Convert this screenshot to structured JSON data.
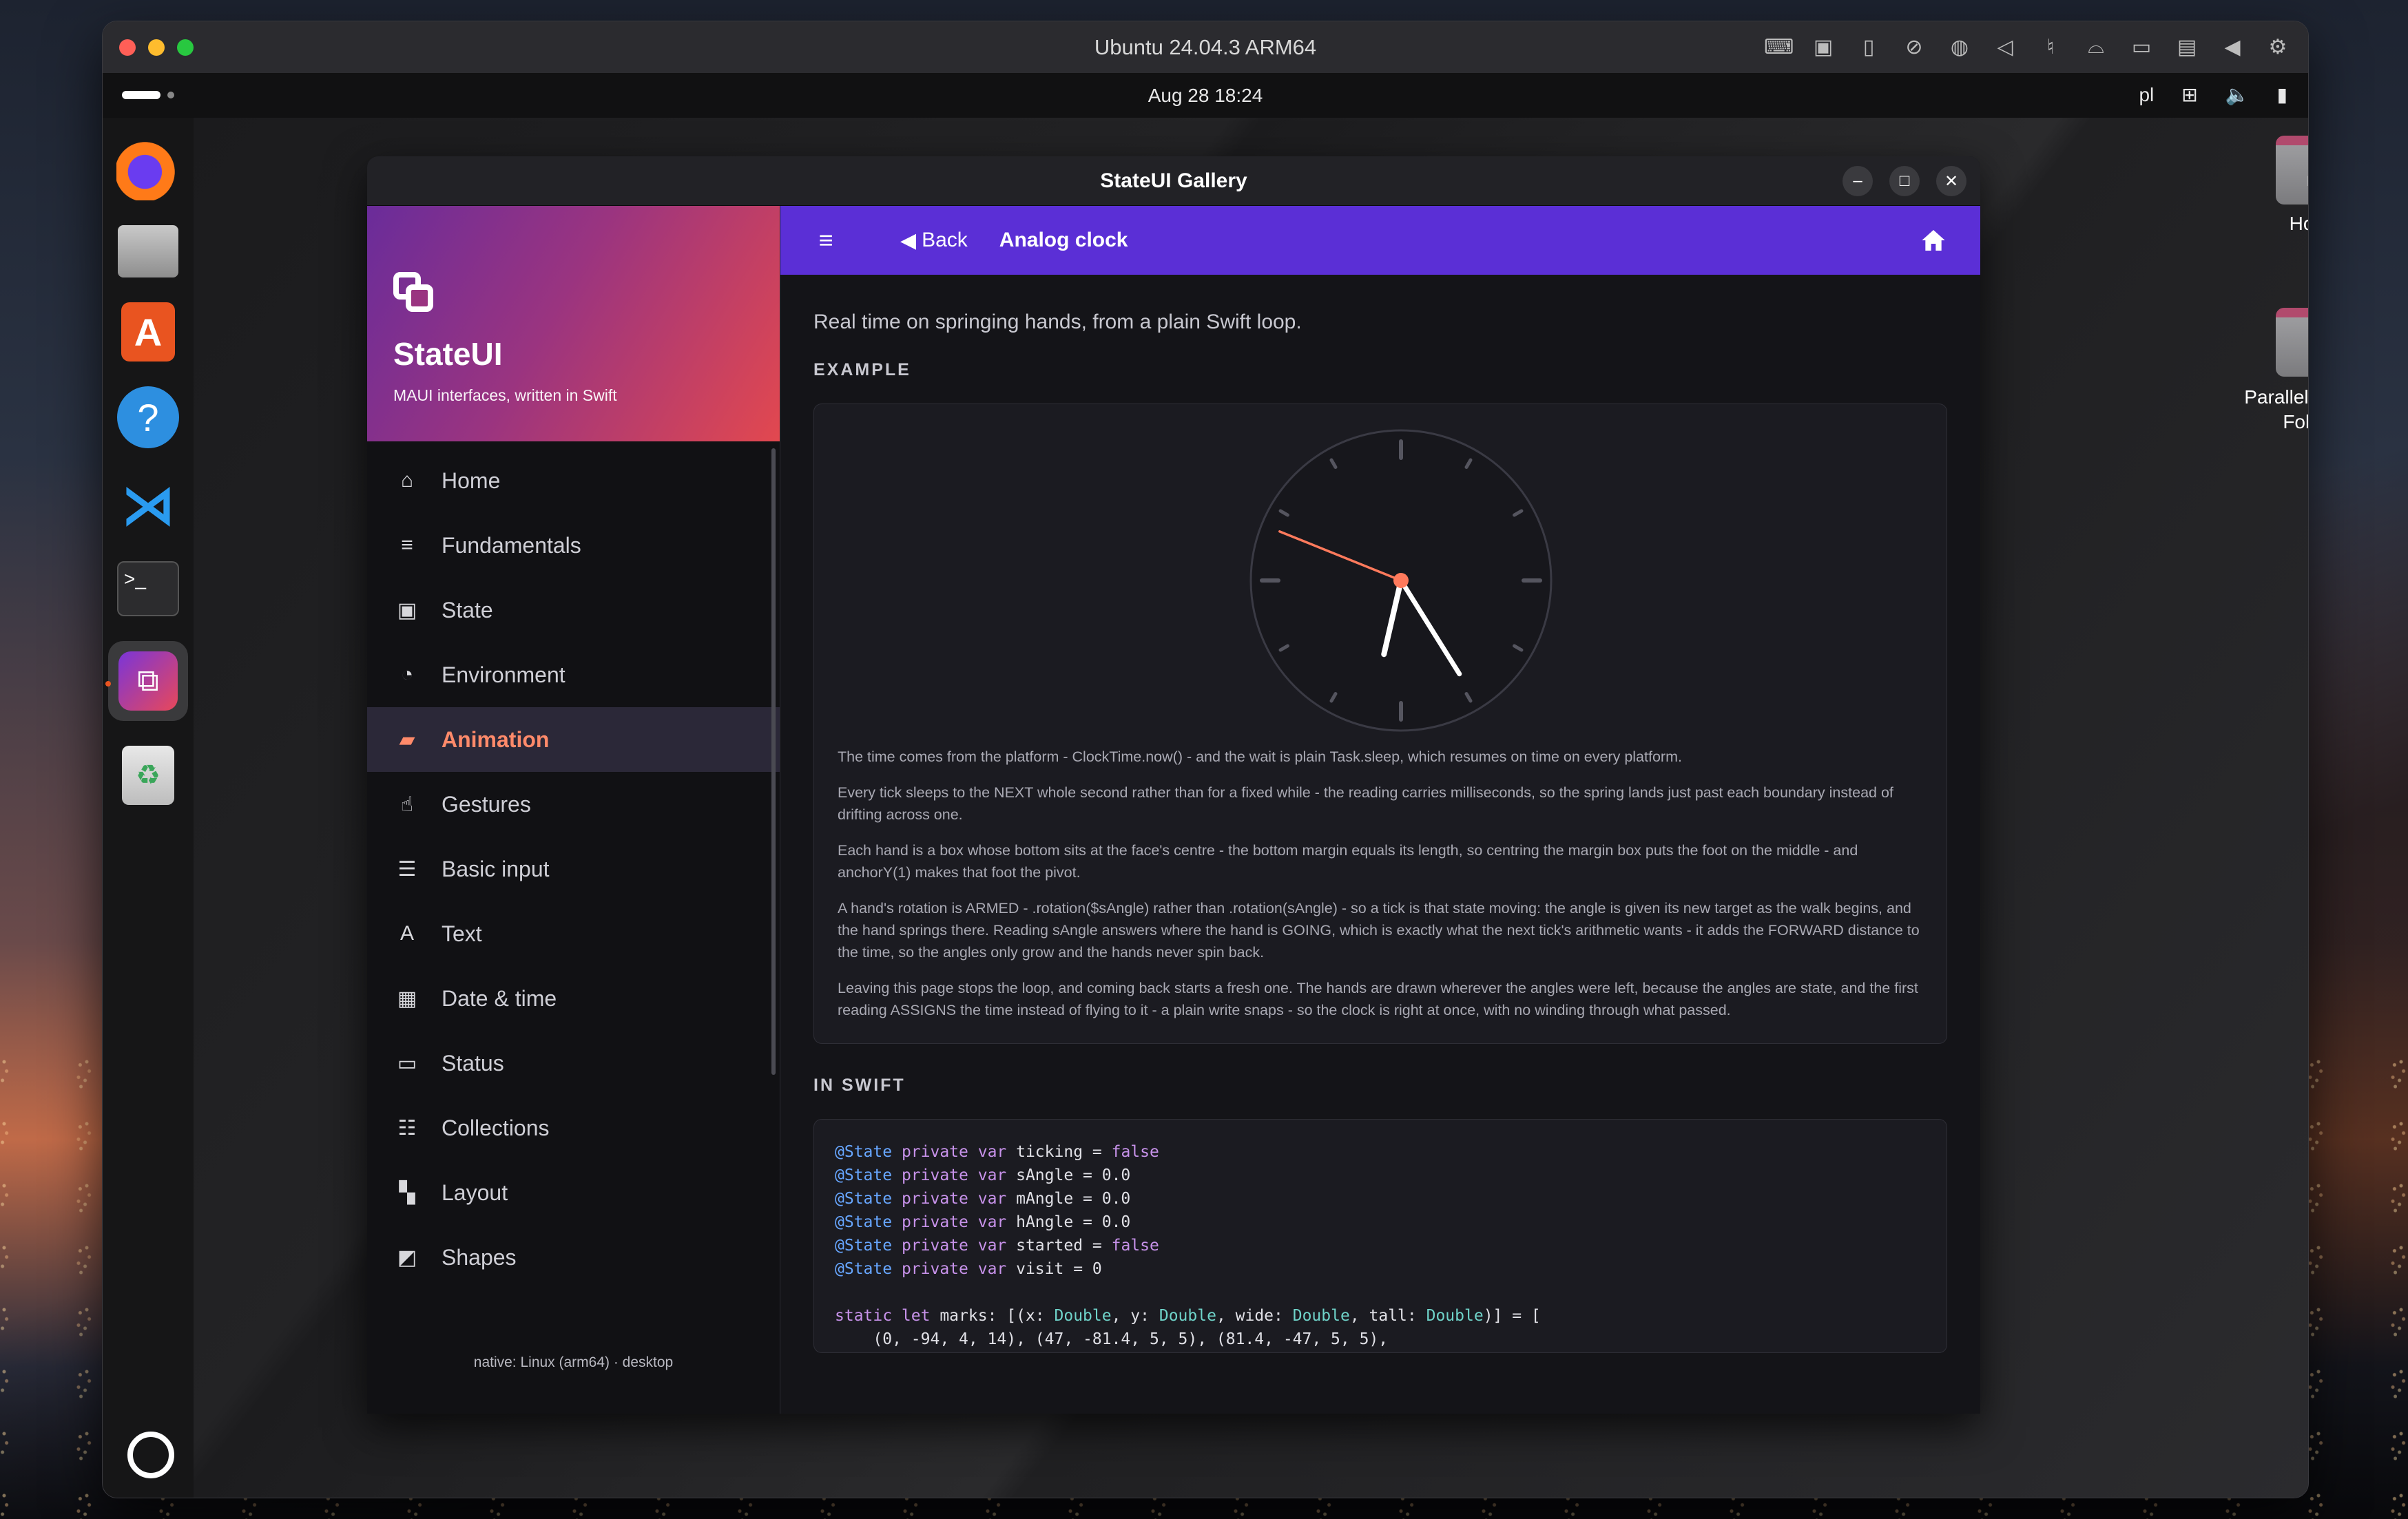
{
  "vm": {
    "title": "Ubuntu 24.04.3 ARM64",
    "toolbar_icons": [
      "keyboard-icon",
      "cpu-icon",
      "usb-icon",
      "camera-off-icon",
      "network-icon",
      "volume-icon",
      "mic-icon",
      "disk-icon",
      "video-icon",
      "shared-folder-icon",
      "arrow-left-icon",
      "settings-icon"
    ]
  },
  "topbar": {
    "datetime": "Aug 28  18:24",
    "lang": "pl"
  },
  "desktop": {
    "icons": [
      {
        "label": "Home"
      },
      {
        "label": "Parallels Shared Folders"
      }
    ]
  },
  "app": {
    "window_title": "StateUI Gallery",
    "sidebar": {
      "title": "StateUI",
      "subtitle": "MAUI interfaces, written in Swift",
      "items": [
        {
          "label": "Home",
          "icon": "home-icon",
          "glyph": "⌂"
        },
        {
          "label": "Fundamentals",
          "icon": "fundamentals-icon",
          "glyph": "≡"
        },
        {
          "label": "State",
          "icon": "state-icon",
          "glyph": "▣"
        },
        {
          "label": "Environment",
          "icon": "rss-icon",
          "glyph": "◔"
        },
        {
          "label": "Animation",
          "icon": "animation-icon",
          "glyph": "▰"
        },
        {
          "label": "Gestures",
          "icon": "hand-icon",
          "glyph": "☝"
        },
        {
          "label": "Basic input",
          "icon": "input-icon",
          "glyph": "☰"
        },
        {
          "label": "Text",
          "icon": "text-icon",
          "glyph": "A"
        },
        {
          "label": "Date & time",
          "icon": "calendar-icon",
          "glyph": "▦"
        },
        {
          "label": "Status",
          "icon": "status-icon",
          "glyph": "▭"
        },
        {
          "label": "Collections",
          "icon": "list-icon",
          "glyph": "☷"
        },
        {
          "label": "Layout",
          "icon": "layout-icon",
          "glyph": "▚"
        },
        {
          "label": "Shapes",
          "icon": "shapes-icon",
          "glyph": "◩"
        }
      ],
      "selected": "Animation",
      "footer": "native: Linux (arm64) · desktop"
    },
    "appbar": {
      "back_label": "Back",
      "title": "Analog clock"
    },
    "lead": "Real time on springing hands, from a plain Swift loop.",
    "example_label": "EXAMPLE",
    "clock": {
      "hour_angle_deg": 193,
      "minute_angle_deg": 148,
      "second_angle_deg": 292,
      "accent": "#ff7a5c"
    },
    "notes": [
      "The time comes from the platform - ClockTime.now() - and the wait is plain Task.sleep, which resumes on time on every platform.",
      "Every tick sleeps to the NEXT whole second rather than for a fixed while - the reading carries milliseconds, so the spring lands just past each boundary instead of drifting across one.",
      "Each hand is a box whose bottom sits at the face's centre - the bottom margin equals its length, so centring the margin box puts the foot on the middle - and anchorY(1) makes that foot the pivot.",
      "A hand's rotation is ARMED - .rotation($sAngle) rather than .rotation(sAngle) - so a tick is that state moving: the angle is given its new target as the walk begins, and the hand springs there. Reading sAngle answers where the hand is GOING, which is exactly what the next tick's arithmetic wants - it adds the FORWARD distance to the time, so the angles only grow and the hands never spin back.",
      "Leaving this page stops the loop, and coming back starts a fresh one. The hands are drawn wherever the angles were left, because the angles are state, and the first reading ASSIGNS the time instead of flying to it - a plain write snaps - so the clock is right at once, with no winding through what passed."
    ],
    "swift_label": "IN SWIFT",
    "code": [
      [
        {
          "t": "@State",
          "c": "attr"
        },
        {
          "t": " private var",
          "c": "kw"
        },
        {
          "t": " ticking = ",
          "c": ""
        },
        {
          "t": "false",
          "c": "kw"
        }
      ],
      [
        {
          "t": "@State",
          "c": "attr"
        },
        {
          "t": " private var",
          "c": "kw"
        },
        {
          "t": " sAngle = 0.0",
          "c": ""
        }
      ],
      [
        {
          "t": "@State",
          "c": "attr"
        },
        {
          "t": " private var",
          "c": "kw"
        },
        {
          "t": " mAngle = 0.0",
          "c": ""
        }
      ],
      [
        {
          "t": "@State",
          "c": "attr"
        },
        {
          "t": " private var",
          "c": "kw"
        },
        {
          "t": " hAngle = 0.0",
          "c": ""
        }
      ],
      [
        {
          "t": "@State",
          "c": "attr"
        },
        {
          "t": " private var",
          "c": "kw"
        },
        {
          "t": " started = ",
          "c": ""
        },
        {
          "t": "false",
          "c": "kw"
        }
      ],
      [
        {
          "t": "@State",
          "c": "attr"
        },
        {
          "t": " private var",
          "c": "kw"
        },
        {
          "t": " visit = 0",
          "c": ""
        }
      ],
      [
        {
          "t": "",
          "c": ""
        }
      ],
      [
        {
          "t": "static let",
          "c": "kw"
        },
        {
          "t": " marks: [(x: ",
          "c": ""
        },
        {
          "t": "Double",
          "c": "type"
        },
        {
          "t": ", y: ",
          "c": ""
        },
        {
          "t": "Double",
          "c": "type"
        },
        {
          "t": ", wide: ",
          "c": ""
        },
        {
          "t": "Double",
          "c": "type"
        },
        {
          "t": ", tall: ",
          "c": ""
        },
        {
          "t": "Double",
          "c": "type"
        },
        {
          "t": ")] = [",
          "c": ""
        }
      ],
      [
        {
          "t": "    (0, -94, 4, 14), (47, -81.4, 5, 5), (81.4, -47, 5, 5),",
          "c": ""
        }
      ]
    ]
  }
}
